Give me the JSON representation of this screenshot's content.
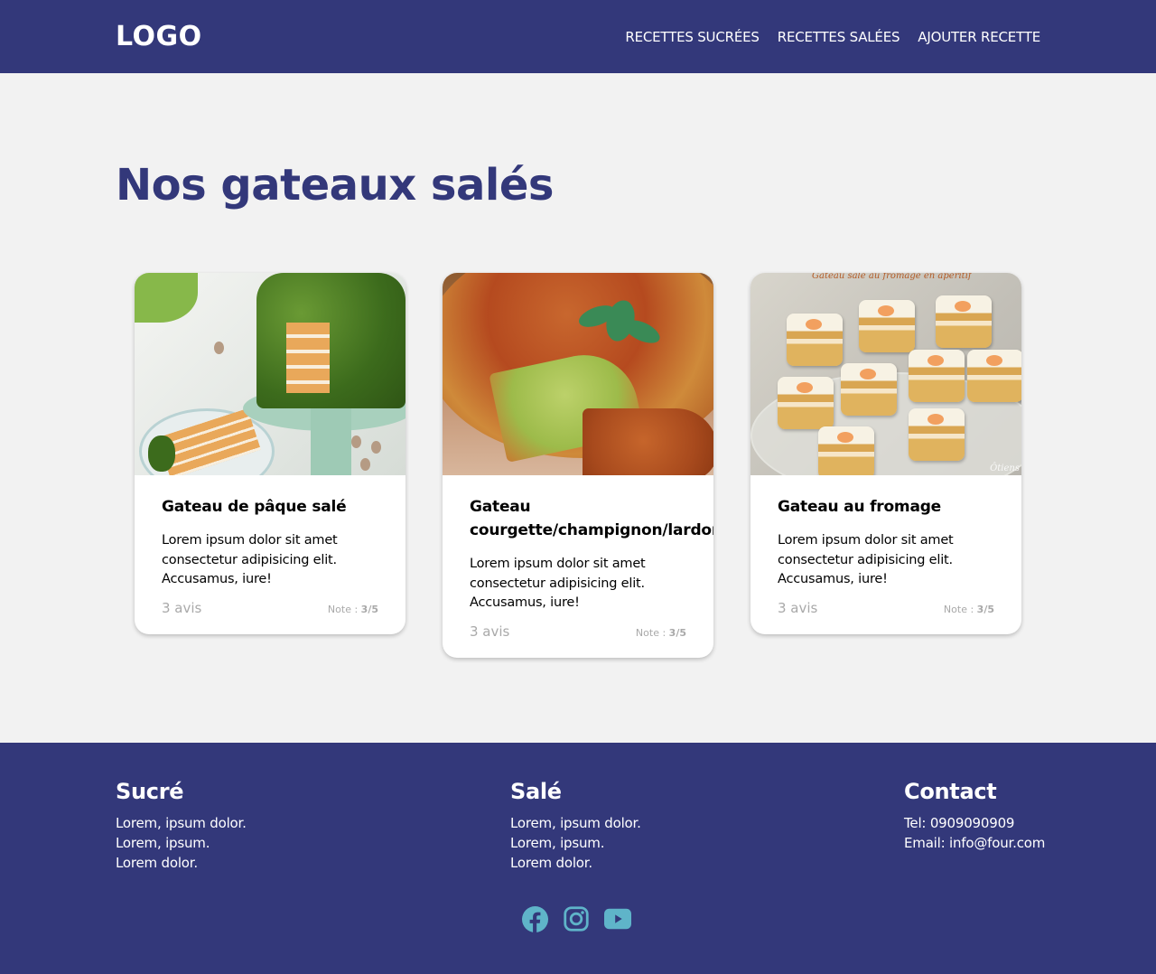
{
  "header": {
    "logo": "LOGO",
    "nav": [
      {
        "label": "RECETTES SUCRÉES"
      },
      {
        "label": "RECETTES SALÉES"
      },
      {
        "label": "AJOUTER RECETTE"
      }
    ]
  },
  "main": {
    "title": "Nos gateaux salés",
    "cards": [
      {
        "title": "Gateau de pâque salé",
        "description": "Lorem ipsum dolor sit amet consectetur adipisicing elit. Accusamus, iure!",
        "reviews": "3 avis",
        "rating_label": "Note : ",
        "rating_value": "3/5",
        "image": "moss-cake-image"
      },
      {
        "title": "Gateau courgette/champignon/lardon",
        "description": "Lorem ipsum dolor sit amet consectetur adipisicing elit. Accusamus, iure!",
        "reviews": "3 avis",
        "rating_label": "Note : ",
        "rating_value": "3/5",
        "image": "quiche-image"
      },
      {
        "title": "Gateau au fromage",
        "description": "Lorem ipsum dolor sit amet consectetur adipisicing elit. Accusamus, iure!",
        "reviews": "3 avis",
        "rating_label": "Note : ",
        "rating_value": "3/5",
        "image": "cheese-cake-image",
        "image_caption": "Gateau salé au fromage en apéritif"
      }
    ]
  },
  "footer": {
    "columns": [
      {
        "title": "Sucré",
        "lines": [
          "Lorem, ipsum dolor.",
          "Lorem, ipsum.",
          "Lorem dolor."
        ]
      },
      {
        "title": "Salé",
        "lines": [
          "Lorem, ipsum dolor.",
          "Lorem, ipsum.",
          "Lorem dolor."
        ]
      },
      {
        "title": "Contact",
        "lines": [
          "Tel: 0909090909",
          "Email: info@four.com"
        ]
      }
    ],
    "socials": [
      "facebook-icon",
      "instagram-icon",
      "youtube-icon"
    ]
  },
  "colors": {
    "brand": "#33387a",
    "background": "#f2f2f2",
    "social_icons": "#5fb4c9",
    "muted_text": "#a9a9a9"
  }
}
